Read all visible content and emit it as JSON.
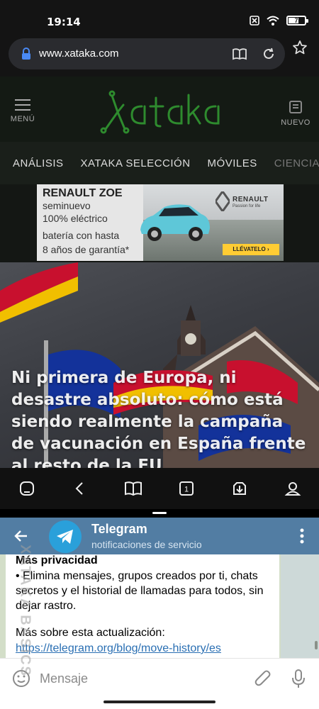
{
  "status_bar": {
    "time": "19:14",
    "battery": "7",
    "battery_level_percent": 7,
    "icons": [
      "notification-off-icon",
      "wifi-icon",
      "battery-icon"
    ]
  },
  "browser": {
    "url": "www.xataka.com",
    "icons": [
      "lock-icon",
      "reader-mode-icon",
      "reload-icon",
      "bookmark-star-icon"
    ],
    "toolbar": {
      "tab_count": "1",
      "icons": [
        "home-icon",
        "back-icon",
        "bookmarks-icon",
        "tabs-icon",
        "download-icon",
        "account-icon"
      ]
    }
  },
  "site": {
    "menu_label": "MENÚ",
    "logo_text": "xataka",
    "new_label": "NUEVO",
    "nav": [
      "ANÁLISIS",
      "XATAKA SELECCIÓN",
      "MÓVILES",
      "CIENCIA"
    ],
    "ad": {
      "title": "RENAULT ZOE",
      "line1": "seminuevo",
      "line2": "100% eléctrico",
      "line3": "batería con hasta",
      "line4": "8 años de garantía*",
      "brand": "RENAULT",
      "brand_tagline": "Passion for life",
      "cta": "LLÉVATELO ›"
    },
    "hero_title": "Ni primera de Europa, ni desastre absoluto: cómo está siendo realmente la campaña de vacunación en España frente al resto de la EU"
  },
  "telegram": {
    "chat_name": "Telegram",
    "chat_status": "notificaciones de servicio",
    "message": {
      "heading": "Más privacidad",
      "body": "• Elimina mensajes, grupos creados por ti, chats secretos y el historial de llamadas para todos, sin dejar rastro.",
      "more": "Más sobre esta actualización:",
      "link": "https://telegram.org/blog/move-history/es"
    },
    "input_placeholder": "Mensaje",
    "icons": [
      "back-arrow-icon",
      "more-vert-icon",
      "emoji-icon",
      "attach-icon",
      "mic-icon"
    ]
  },
  "watermark": "XATAKA BASICS",
  "colors": {
    "xataka_green": "#2e8b2e",
    "telegram_header": "#527da3",
    "telegram_link": "#2a6fb3"
  }
}
